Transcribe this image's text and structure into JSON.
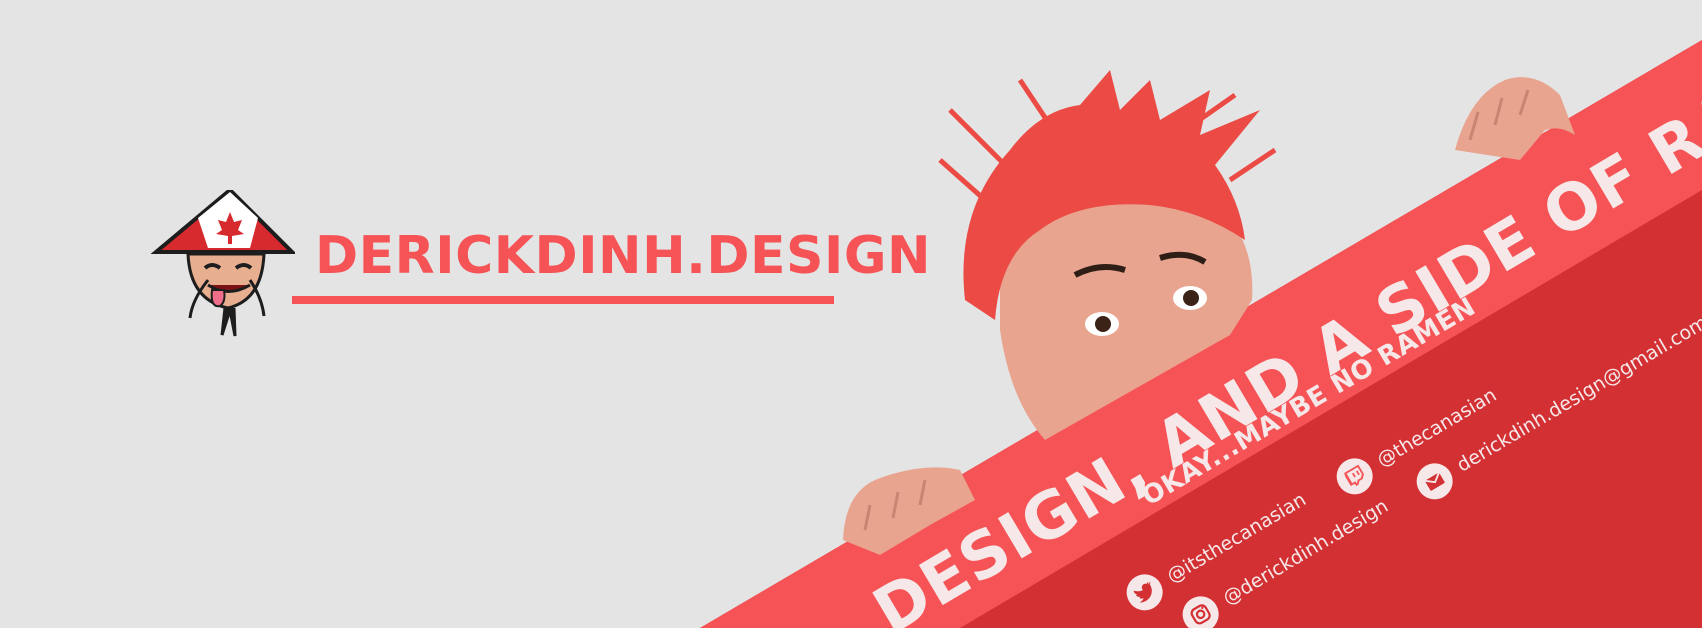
{
  "site": {
    "title": "DERICKDINH.DESIGN"
  },
  "banner": {
    "headline": "DESIGN, AND A SIDE OF RAMEN",
    "subline": "OKAY...MAYBE NO RAMEN"
  },
  "contacts": {
    "twitch": "@thecanasian",
    "email": "derickdinh.design@gmail.com",
    "twitter": "@itsthecanasian",
    "instagram": "@derickdinh.design"
  },
  "colors": {
    "background": "#e4e4e4",
    "accent": "#f55356",
    "stripe_light": "#f55356",
    "stripe_dark": "#d33034",
    "text_light": "#f6e8e8"
  },
  "icons": {
    "logo": "canadian-hat-mascot-icon",
    "twitch": "twitch-icon",
    "email": "mail-icon",
    "twitter": "twitter-bird-icon",
    "instagram": "instagram-icon"
  }
}
